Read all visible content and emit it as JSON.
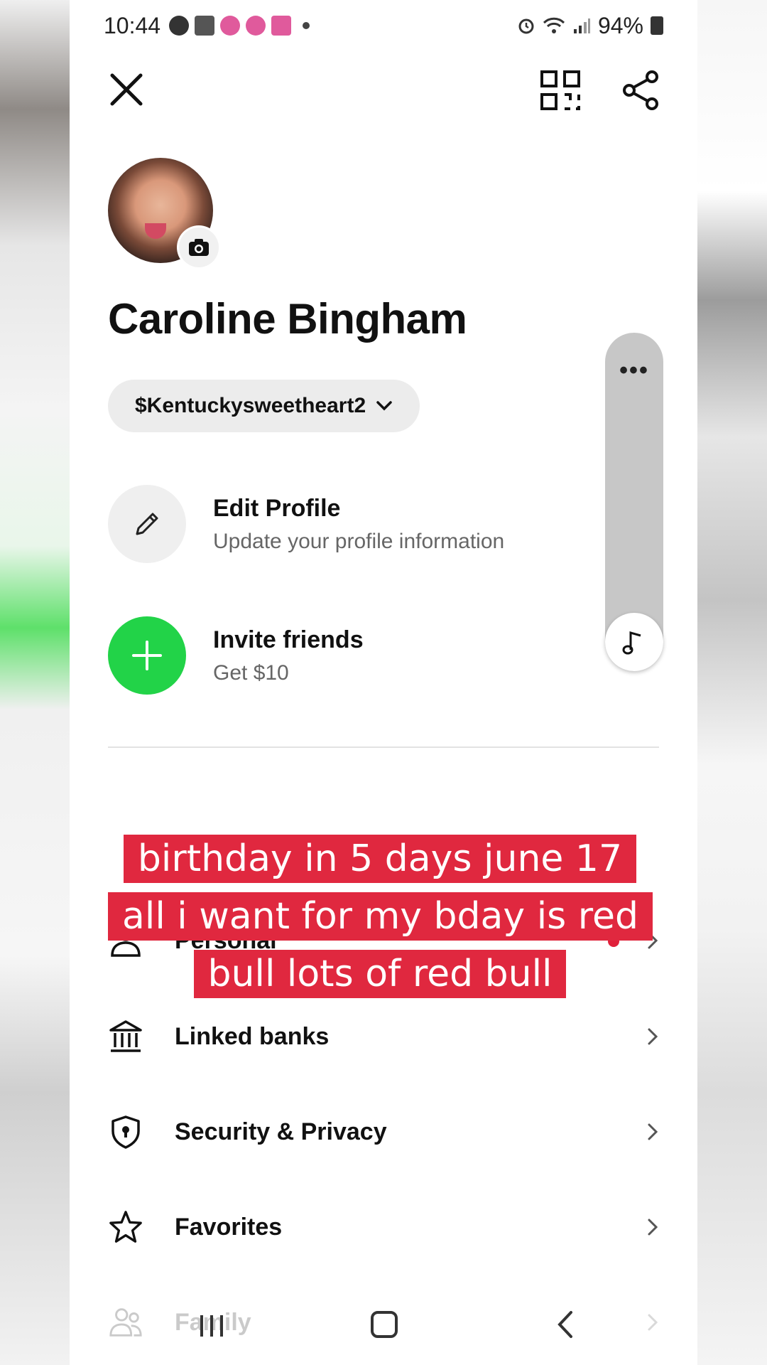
{
  "status_bar": {
    "time": "10:44",
    "notification_icons": [
      "messenger-icon",
      "capcut-icon",
      "tiktok-icon",
      "tiktok-icon",
      "tmobile-play-icon"
    ],
    "battery": "94%",
    "system_icons": [
      "alarm-icon",
      "wifi-icon",
      "signal-icon",
      "battery-icon"
    ]
  },
  "header": {
    "close_icon": "close-icon",
    "qr_icon": "qr-scan-icon",
    "share_icon": "share-icon"
  },
  "profile": {
    "name": "Caroline Bingham",
    "cashtag": "$Kentuckysweetheart2"
  },
  "actions": [
    {
      "title": "Edit Profile",
      "subtitle": "Update your profile information",
      "icon": "pencil-icon"
    },
    {
      "title": "Invite friends",
      "subtitle": "Get $10",
      "icon": "plus-icon"
    }
  ],
  "menu": [
    {
      "label": "Personal",
      "icon": "person-icon"
    },
    {
      "label": "Linked banks",
      "icon": "bank-icon"
    },
    {
      "label": "Security & Privacy",
      "icon": "shield-icon"
    },
    {
      "label": "Favorites",
      "icon": "star-icon"
    },
    {
      "label": "Family",
      "icon": "family-icon"
    }
  ],
  "overlay": {
    "caption": "birthday in 5 days june 17 all i want for my bday is red bull lots of red bull",
    "side_more": "•••",
    "side_music_icon": "music-note-icon"
  },
  "colors": {
    "accent_green": "#22d348",
    "caption_red": "#e0283f"
  }
}
